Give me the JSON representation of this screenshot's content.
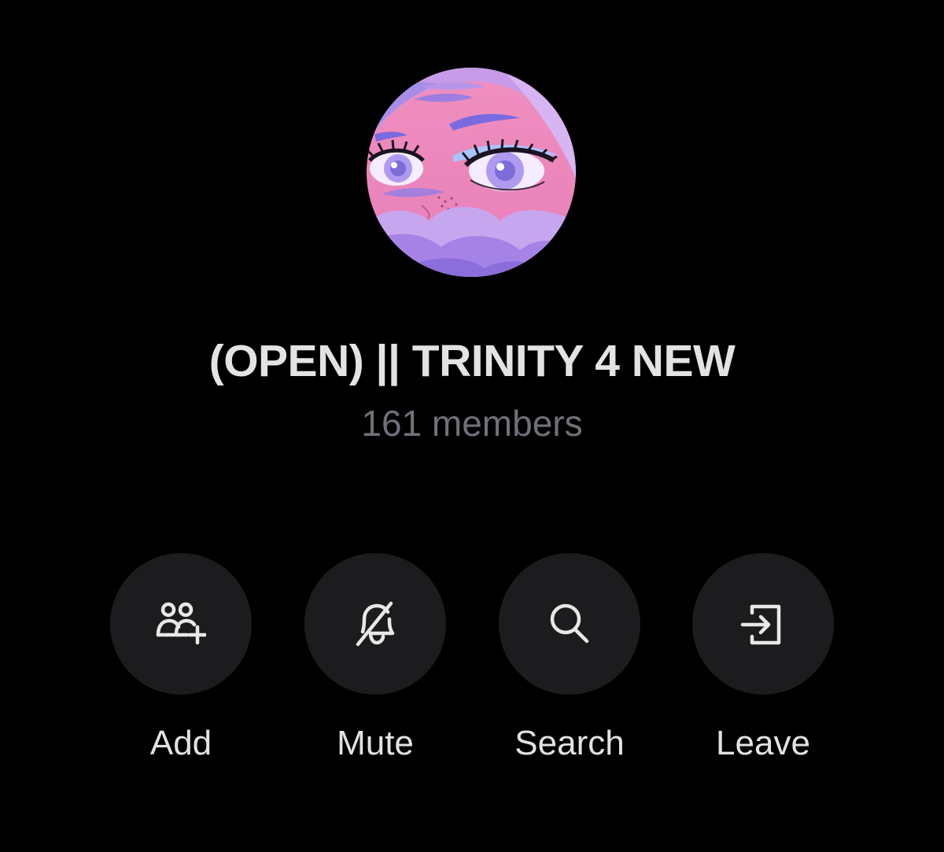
{
  "group": {
    "title": "(OPEN) || TRINITY 4 NEW",
    "subtitle": "161 members",
    "avatar_icon": "anime-eyes-pink-illustration"
  },
  "actions": [
    {
      "label": "Add",
      "icon": "add-members-icon"
    },
    {
      "label": "Mute",
      "icon": "bell-slash-icon"
    },
    {
      "label": "Search",
      "icon": "search-icon"
    },
    {
      "label": "Leave",
      "icon": "leave-icon"
    }
  ],
  "colors": {
    "background": "#000000",
    "button_bg": "#1c1c1e",
    "title": "#e3e3e3",
    "subtitle": "#6e7178",
    "icon": "#e8e8e8"
  }
}
